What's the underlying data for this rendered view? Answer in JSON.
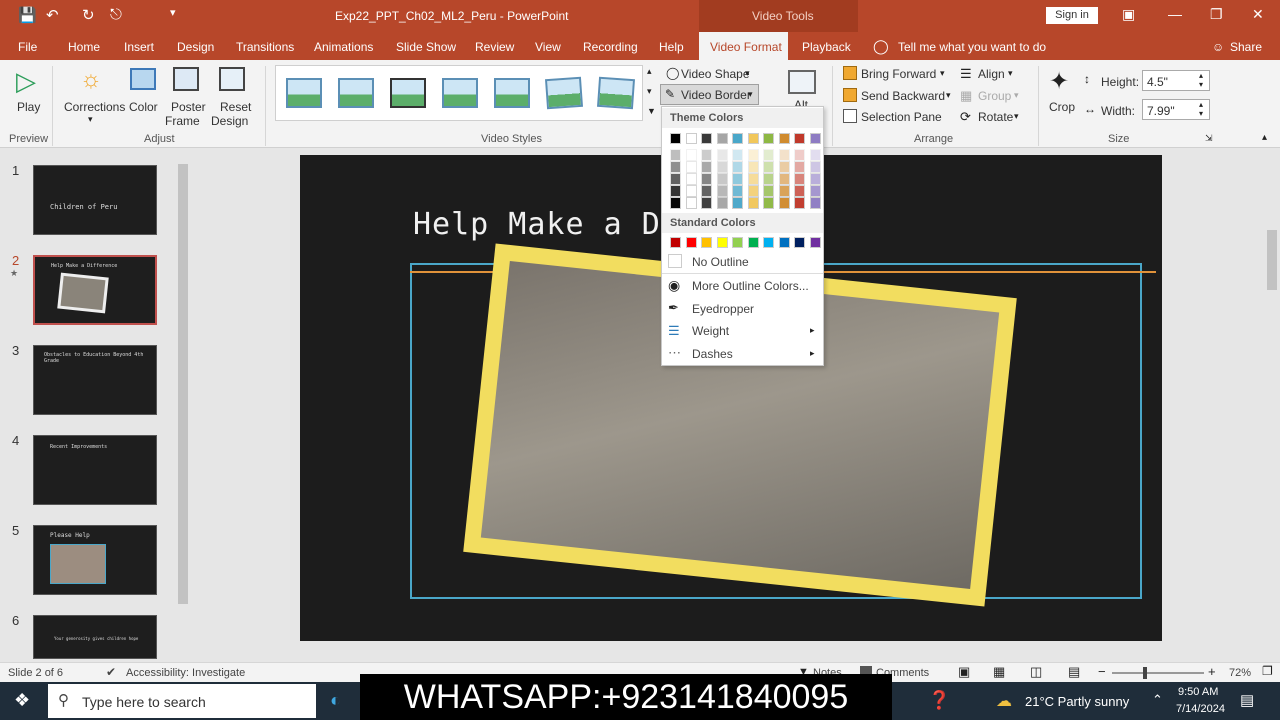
{
  "app": {
    "title": "Exp22_PPT_Ch02_ML2_Peru  -  PowerPoint",
    "tool_context": "Video Tools",
    "signin": "Sign in"
  },
  "tabs": [
    "File",
    "Home",
    "Insert",
    "Design",
    "Transitions",
    "Animations",
    "Slide Show",
    "Review",
    "View",
    "Recording",
    "Help",
    "Video Format",
    "Playback"
  ],
  "tell_me": "Tell me what you want to do",
  "share": "Share",
  "ribbon": {
    "preview": {
      "play": "Play",
      "group": "Preview"
    },
    "adjust": {
      "corrections": "Corrections",
      "color": "Color",
      "poster": "Poster",
      "poster2": "Frame",
      "reset": "Reset",
      "reset2": "Design",
      "group": "Adjust"
    },
    "video_styles": {
      "group": "Video Styles",
      "video_shape": "Video Shape",
      "video_border": "Video Border",
      "video_effects": "Alt"
    },
    "arrange": {
      "bring_forward": "Bring Forward",
      "send_backward": "Send Backward",
      "selection_pane": "Selection Pane",
      "align": "Align",
      "group_btn": "Group",
      "rotate": "Rotate",
      "group": "Arrange"
    },
    "size": {
      "crop": "Crop",
      "height_label": "Height:",
      "height": "4.5\"",
      "width_label": "Width:",
      "width": "7.99\"",
      "group": "Size"
    }
  },
  "thumbnails": [
    {
      "num": "1",
      "title": "Children of Peru"
    },
    {
      "num": "2",
      "title": "Help Make a Difference"
    },
    {
      "num": "3",
      "title": "Obstacles to Education Beyond 4th Grade"
    },
    {
      "num": "4",
      "title": "Recent Improvements"
    },
    {
      "num": "5",
      "title": "Please Help"
    },
    {
      "num": "6",
      "title": "Your generosity gives children hope"
    }
  ],
  "slide": {
    "title": "Help Make a D          e"
  },
  "border_menu": {
    "theme_colors": "Theme Colors",
    "standard_colors": "Standard Colors",
    "no_outline": "No Outline",
    "more_colors": "More Outline Colors...",
    "eyedropper": "Eyedropper",
    "weight": "Weight",
    "dashes": "Dashes",
    "theme_row": [
      "#000000",
      "#ffffff",
      "#3a3a3a",
      "#a6a6a6",
      "#4aa7c9",
      "#f1c75b",
      "#8eb844",
      "#d08b2f",
      "#c0392b",
      "#8e7cc3"
    ],
    "standard_row": [
      "#c00000",
      "#ff0000",
      "#ffc000",
      "#ffff00",
      "#92d050",
      "#00b050",
      "#00b0f0",
      "#0070c0",
      "#002060",
      "#7030a0"
    ]
  },
  "status": {
    "slide": "Slide 2 of 6",
    "accessibility": "Accessibility: Investigate",
    "notes": "Notes",
    "comments": "Comments",
    "zoom": "72%"
  },
  "taskbar": {
    "search": "Type here to search",
    "weather": "21°C  Partly sunny",
    "time": "9:50 AM",
    "date": "7/14/2024"
  },
  "overlay": {
    "text": "WHATSAPP:+923141840095"
  }
}
